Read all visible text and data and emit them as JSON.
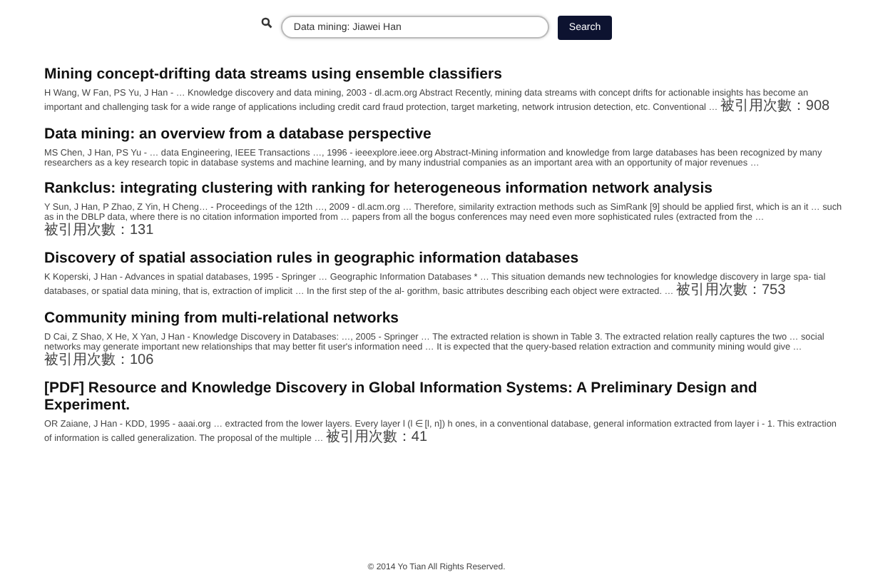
{
  "search": {
    "value": "Data mining: Jiawei Han",
    "button": "Search"
  },
  "results": [
    {
      "title": "Mining concept-drifting data streams using ensemble classifiers",
      "snippet": "H Wang, W Fan, PS Yu, J Han - … Knowledge discovery and data mining, 2003 - dl.acm.org Abstract Recently, mining data streams with concept drifts for actionable insights has become an important and challenging task for a wide range of applications including credit card fraud protection, target marketing, network intrusion detection, etc. Conventional …",
      "cited": "被引用次數：908"
    },
    {
      "title": "Data mining: an overview from a database perspective",
      "snippet": "MS Chen, J Han, PS Yu - … data Engineering, IEEE Transactions …, 1996 - ieeexplore.ieee.org Abstract-Mining information and knowledge from large databases has been recognized by many researchers as a key research topic in database systems and machine learning, and by many industrial companies as an important area with an opportunity of major revenues …"
    },
    {
      "title": "Rankclus: integrating clustering with ranking for heterogeneous information network analysis",
      "snippet": "Y Sun, J Han, P Zhao, Z Yin, H Cheng… - Proceedings of the 12th …, 2009 - dl.acm.org … Therefore, similarity extraction methods such as SimRank [9] should be applied first, which is an it … such as in the DBLP data, where there is no citation information imported from … papers from all the bogus conferences may need even more sophisticated rules (extracted from the …",
      "cited": "被引用次數：131"
    },
    {
      "title": "Discovery of spatial association rules in geographic information databases",
      "snippet": "K Koperski, J Han - Advances in spatial databases, 1995 - Springer … Geographic Information Databases * … This situation demands new technologies for knowledge discovery in large spa- tial databases, or spatial data mining, that is, extraction of implicit … In the first step of the al- gorithm, basic attributes describing each object were extracted. …",
      "cited": "被引用次數：753"
    },
    {
      "title": "Community mining from multi-relational networks",
      "snippet": "D Cai, Z Shao, X He, X Yan, J Han - Knowledge Discovery in Databases: …, 2005 - Springer … The extracted relation is shown in Table 3. The extracted relation really captures the two … social networks may generate important new relationships that may better fit user's information need … It is expected that the query-based relation extraction and community mining would give …",
      "cited": "被引用次數：106"
    },
    {
      "title": "[PDF] Resource and Knowledge Discovery in Global Information Systems: A Preliminary Design and Experiment.",
      "snippet": "OR Zaiane, J Han - KDD, 1995 - aaai.org … extracted from the lower layers. Every layer l (l ∈ [l, n]) h ones, in a conventional database, general information extracted from layer i - 1. This extraction of information is called generalization. The proposal of the multiple …",
      "cited": "被引用次數：41"
    }
  ],
  "footer": "© 2014 Yo Tian All Rights Reserved."
}
